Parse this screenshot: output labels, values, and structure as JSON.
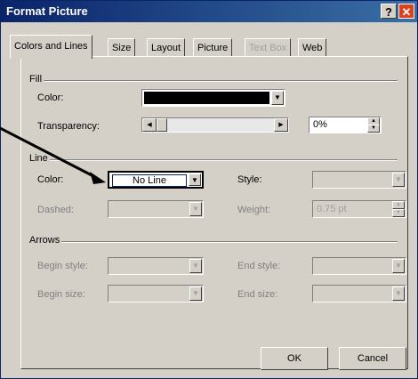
{
  "window": {
    "title": "Format Picture",
    "help_glyph": "?",
    "close_glyph": "✕"
  },
  "tabs": [
    {
      "label": "Colors and Lines",
      "active": true
    },
    {
      "label": "Size"
    },
    {
      "label": "Layout"
    },
    {
      "label": "Picture"
    },
    {
      "label": "Text Box",
      "disabled": true
    },
    {
      "label": "Web"
    }
  ],
  "fill": {
    "group": "Fill",
    "color_label": "Color:",
    "color_value": "#000000",
    "transparency_label": "Transparency:",
    "transparency_value": "0%",
    "transparency_level": 0
  },
  "line": {
    "group": "Line",
    "color_label": "Color:",
    "color_value": "No Line",
    "style_label": "Style:",
    "dashed_label": "Dashed:",
    "weight_label": "Weight:",
    "weight_value": "0.75 pt"
  },
  "arrows": {
    "group": "Arrows",
    "begin_style_label": "Begin style:",
    "end_style_label": "End style:",
    "begin_size_label": "Begin size:",
    "end_size_label": "End size:"
  },
  "buttons": {
    "ok": "OK",
    "cancel": "Cancel"
  },
  "icons": {
    "dropdown": "▼",
    "left_arrow": "◀",
    "right_arrow": "▶",
    "spin_up": "▲",
    "spin_down": "▼"
  },
  "annotation_arrow_color": "#000000"
}
